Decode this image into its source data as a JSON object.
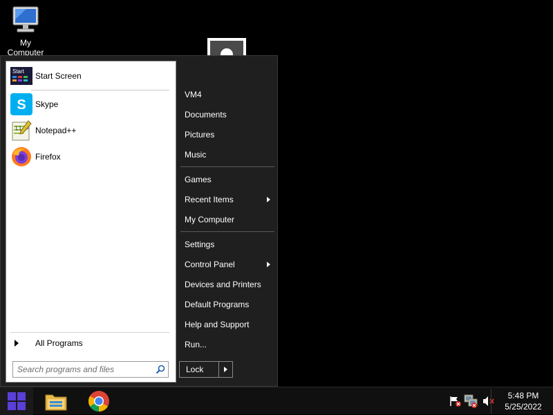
{
  "desktop": {
    "icons": [
      {
        "label": "My Computer",
        "icon": "computer-monitor-icon"
      }
    ]
  },
  "start_menu": {
    "left": {
      "programs": [
        {
          "label": "Start Screen",
          "icon": "start-screen-icon"
        },
        {
          "label": "Skype",
          "icon": "skype-icon"
        },
        {
          "label": "Notepad++",
          "icon": "notepadpp-icon"
        },
        {
          "label": "Firefox",
          "icon": "firefox-icon"
        }
      ],
      "all_programs_label": "All Programs",
      "search_placeholder": "Search programs and files"
    },
    "right": {
      "user_avatar": "user-silhouette-icon",
      "items_group1": [
        "VM4",
        "Documents",
        "Pictures",
        "Music"
      ],
      "items_group2": [
        "Games",
        "Recent Items",
        "My Computer"
      ],
      "items_group3": [
        "Settings",
        "Control Panel",
        "Devices and Printers",
        "Default Programs",
        "Help and Support",
        "Run..."
      ],
      "lock_label": "Lock"
    }
  },
  "taskbar": {
    "apps": [
      "file-explorer-icon",
      "chrome-icon"
    ],
    "tray": [
      "action-center-flag-icon",
      "network-disconnected-icon",
      "volume-muted-icon"
    ],
    "time": "5:48 PM",
    "date": "5/25/2022"
  },
  "colors": {
    "start_accent": "#5a3fd8",
    "menu_bg": "#1f1f1f"
  }
}
